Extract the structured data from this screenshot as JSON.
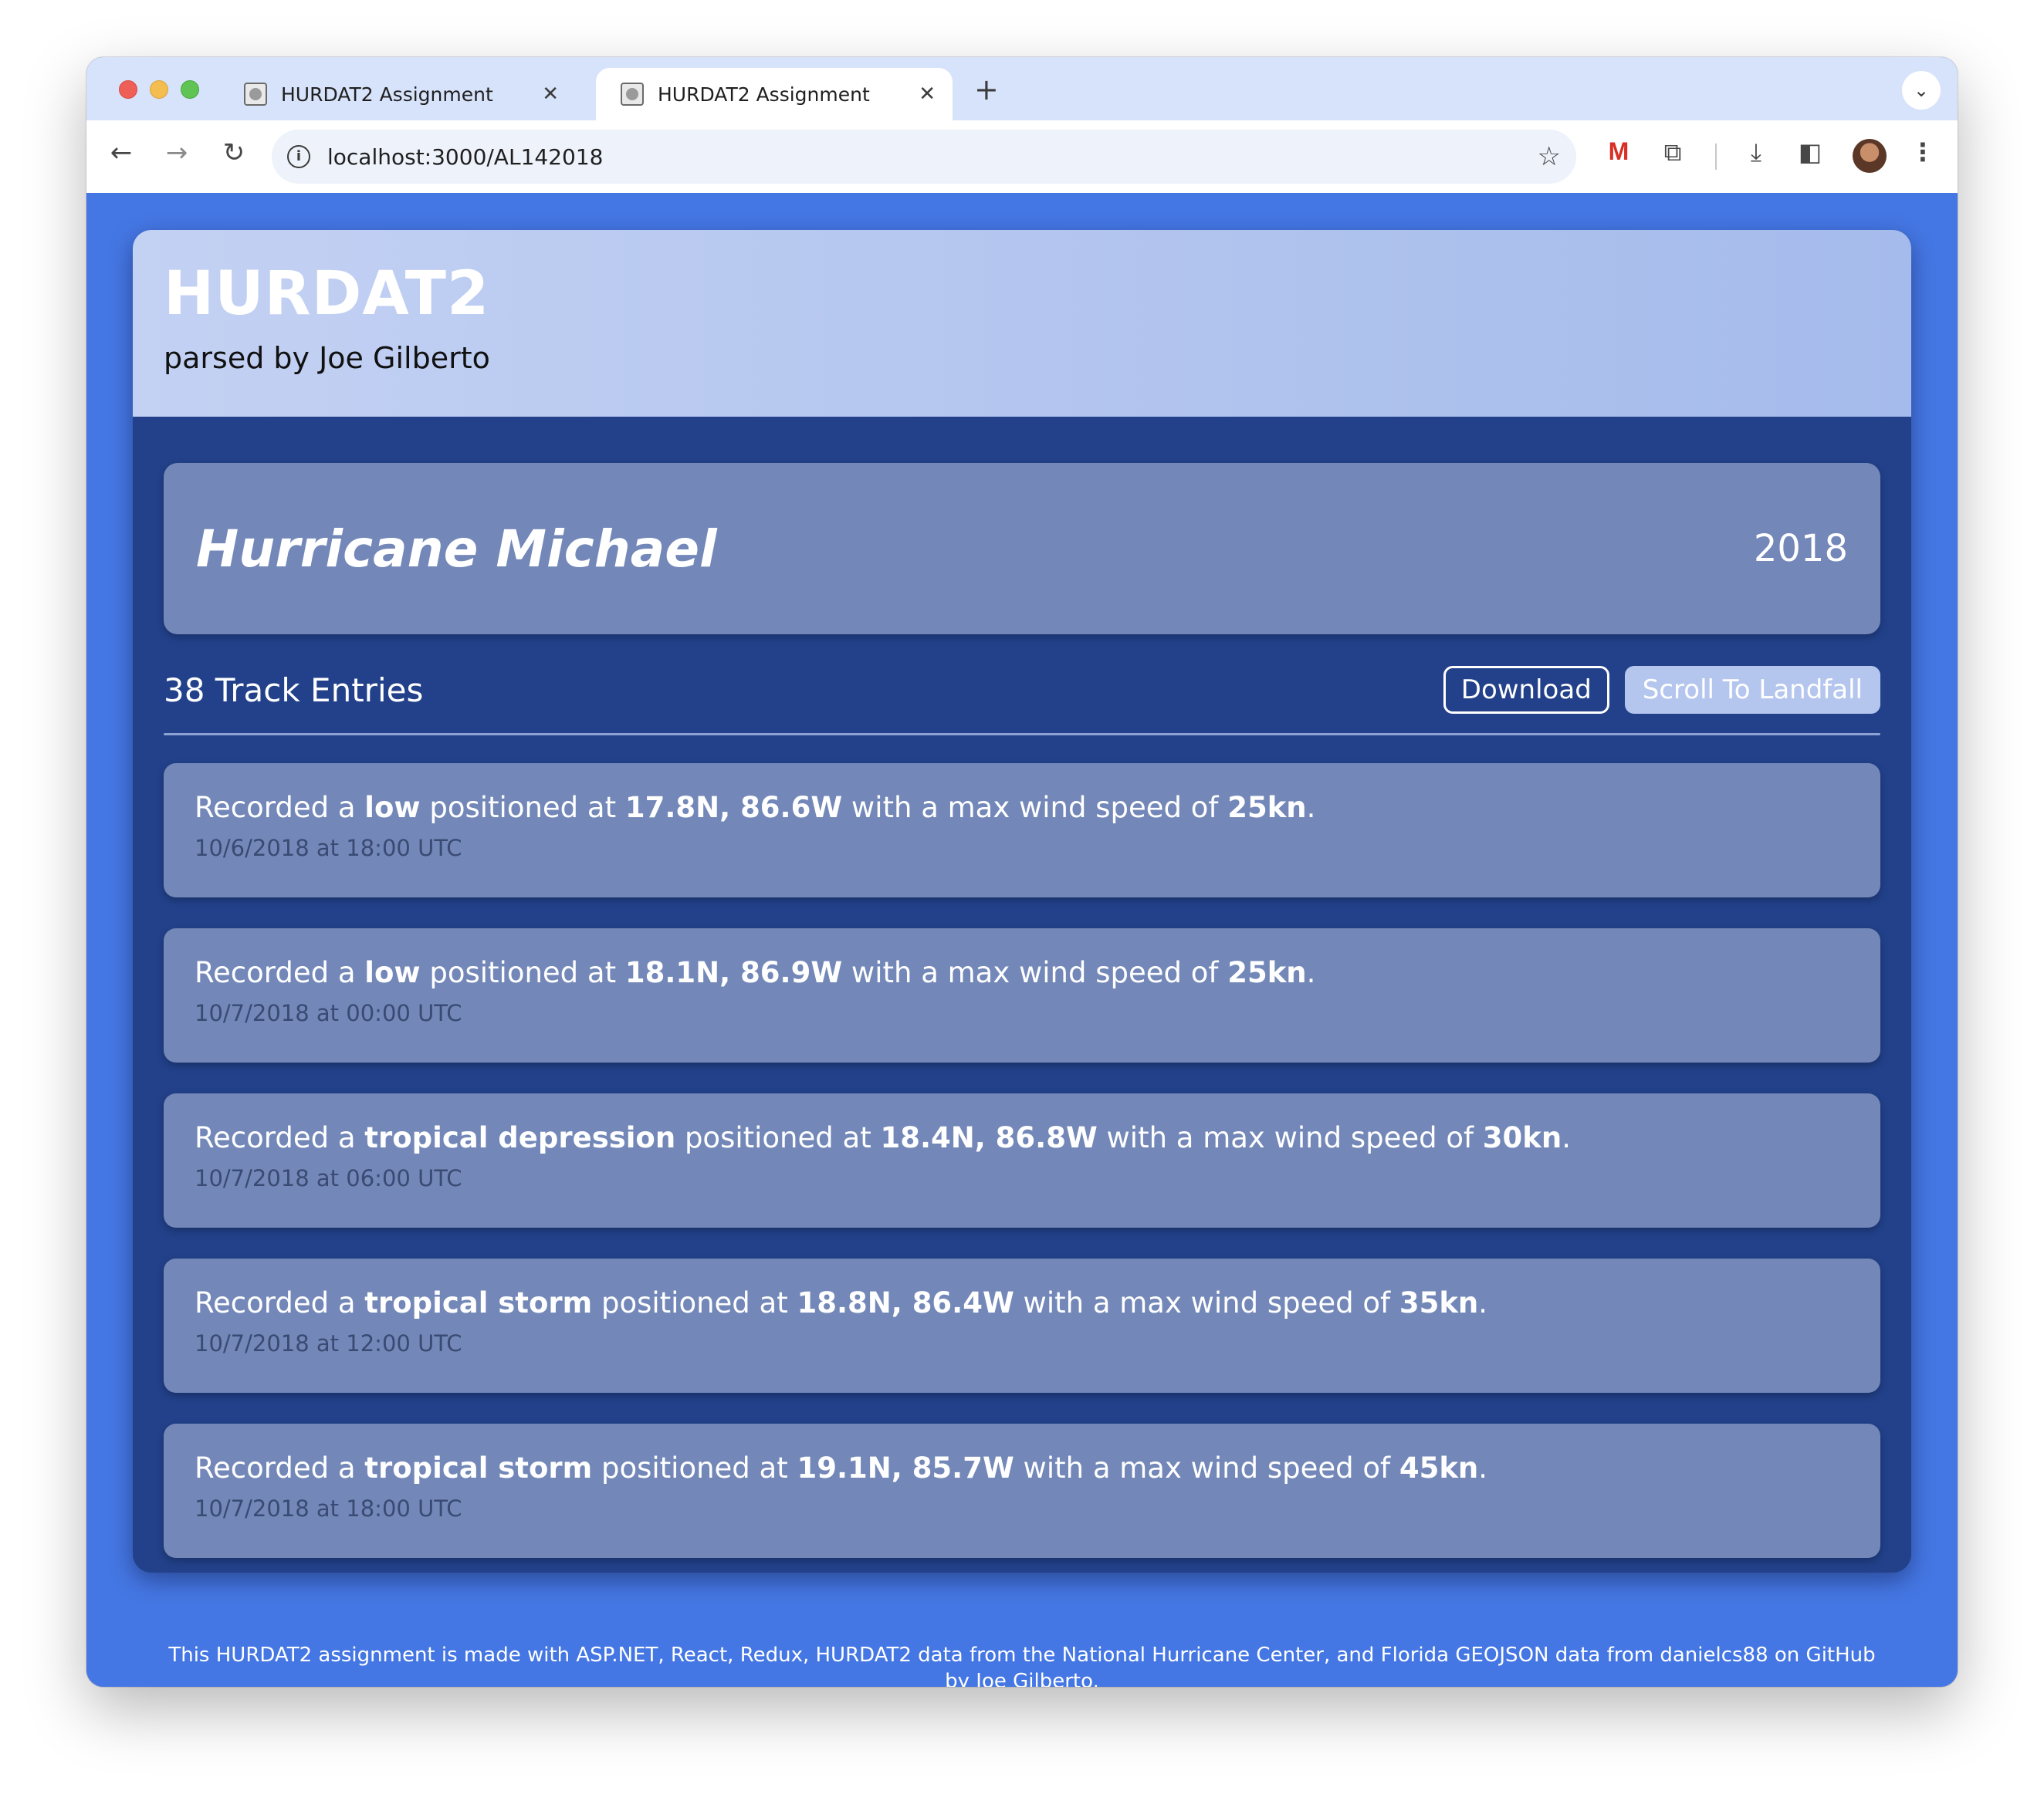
{
  "browser": {
    "tabs": [
      {
        "title": "HURDAT2 Assignment",
        "active": false
      },
      {
        "title": "HURDAT2 Assignment",
        "active": true
      }
    ],
    "url": "localhost:3000/AL142018"
  },
  "header": {
    "title": "HURDAT2",
    "subtitle": "parsed by Joe Gilberto"
  },
  "storm": {
    "name": "Hurricane Michael",
    "year": "2018"
  },
  "entries": {
    "count_label": "38 Track Entries",
    "download_label": "Download",
    "landfall_label": "Scroll To Landfall"
  },
  "track": [
    {
      "prefix": "Recorded a ",
      "status": "low",
      "mid1": " positioned at ",
      "position": "17.8N, 86.6W",
      "mid2": " with a max wind speed of ",
      "wind": "25kn",
      "suffix": ".",
      "time": "10/6/2018 at 18:00 UTC"
    },
    {
      "prefix": "Recorded a ",
      "status": "low",
      "mid1": " positioned at ",
      "position": "18.1N, 86.9W",
      "mid2": " with a max wind speed of ",
      "wind": "25kn",
      "suffix": ".",
      "time": "10/7/2018 at 00:00 UTC"
    },
    {
      "prefix": "Recorded a ",
      "status": "tropical depression",
      "mid1": " positioned at ",
      "position": "18.4N, 86.8W",
      "mid2": " with a max wind speed of ",
      "wind": "30kn",
      "suffix": ".",
      "time": "10/7/2018 at 06:00 UTC"
    },
    {
      "prefix": "Recorded a ",
      "status": "tropical storm",
      "mid1": " positioned at ",
      "position": "18.8N, 86.4W",
      "mid2": " with a max wind speed of ",
      "wind": "35kn",
      "suffix": ".",
      "time": "10/7/2018 at 12:00 UTC"
    },
    {
      "prefix": "Recorded a ",
      "status": "tropical storm",
      "mid1": " positioned at ",
      "position": "19.1N, 85.7W",
      "mid2": " with a max wind speed of ",
      "wind": "45kn",
      "suffix": ".",
      "time": "10/7/2018 at 18:00 UTC"
    }
  ],
  "footer": {
    "text": "This HURDAT2 assignment is made with ASP.NET, React, Redux, HURDAT2 data from the National Hurricane Center, and Florida GEOJSON data from danielcs88 on GitHub by Joe Gilberto."
  },
  "colors": {
    "page_background": "#4577e4",
    "panel": "#22418a",
    "card": "#7388b8"
  }
}
